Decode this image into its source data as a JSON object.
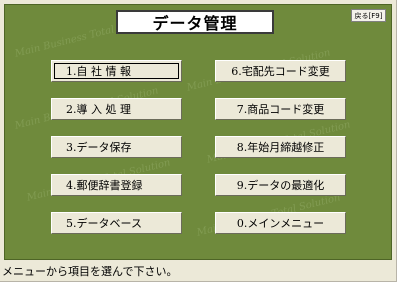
{
  "screen": {
    "title": "データ管理",
    "back_button": "戻る[F9]",
    "watermark": "Main Business Total Solution"
  },
  "menu": {
    "left": [
      "1.自 社 情 報",
      "2.導 入 処 理",
      "3.データ保存",
      "4.郵便辞書登録",
      "5.データベース"
    ],
    "right": [
      "6.宅配先コード変更",
      "7.商品コード変更",
      "8.年始月締越修正",
      "9.データの最適化",
      "0.メインメニュー"
    ]
  },
  "status_bar": {
    "message": "メニューから項目を選んで下さい。"
  },
  "colors": {
    "panel": "#6f8a3c",
    "button_face": "#ece9d8",
    "frame": "#ece9d8"
  }
}
